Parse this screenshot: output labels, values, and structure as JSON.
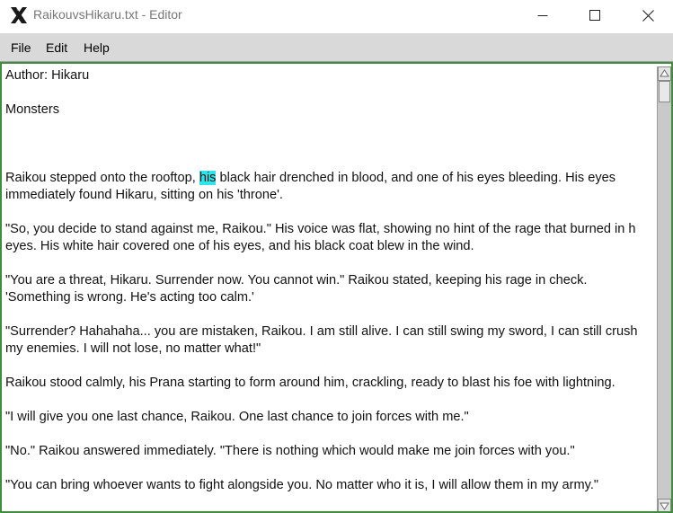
{
  "window": {
    "title": "RaikouvsHikaru.txt - Editor",
    "app_icon": "x-logo-icon",
    "controls": {
      "minimize": "minimize-icon",
      "maximize": "maximize-icon",
      "close": "close-icon"
    }
  },
  "menu": {
    "file": "File",
    "edit": "Edit",
    "help": "Help"
  },
  "document": {
    "lines": [
      "Author: Hikaru",
      "",
      "Monsters",
      "",
      "",
      "",
      "Raikou stepped onto the rooftop, ",
      "immediately found Hikaru, sitting on his 'throne'.",
      "",
      "\"So, you decide to stand against me, Raikou.\" His voice was flat, showing no hint of the rage that burned in h",
      "eyes. His white hair covered one of his eyes, and his black coat blew in the wind.",
      "",
      "\"You are a threat, Hikaru. Surrender now. You cannot win.\" Raikou stated, keeping his rage in check.",
      "'Something is wrong. He's acting too calm.'",
      "",
      "\"Surrender? Hahahaha... you are mistaken, Raikou. I am still alive. I can still swing my sword, I can still crush",
      "my enemies. I will not lose, no matter what!\"",
      "",
      "Raikou stood calmly, his Prana starting to form around him, crackling, ready to blast his foe with lightning.",
      "",
      "\"I will give you one last chance, Raikou. One last chance to join forces with me.\"",
      "",
      "\"No.\" Raikou answered immediately. \"There is nothing which would make me join forces with you.\"",
      "",
      "\"You can bring whoever wants to fight alongside you. No matter who it is, I will allow them in my army.\"",
      "",
      "\"  \""
    ],
    "highlight_word": "his",
    "highlight_after": " black hair drenched in blood, and one of his eyes bleeding. His eyes",
    "highlight_color": "#2fe4ea"
  },
  "colors": {
    "frame_border": "#3e8e3e",
    "menubar_bg": "#d9d9d9"
  }
}
